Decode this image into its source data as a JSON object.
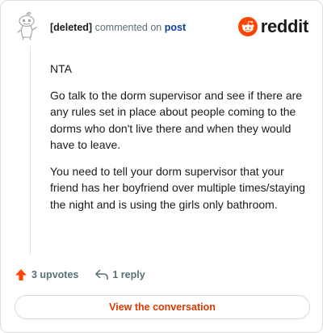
{
  "comment": {
    "author": "[deleted]",
    "action": "commented on",
    "target": "post",
    "paragraphs": [
      "NTA",
      "Go talk to the dorm supervisor and see if there are any rules set in place about people coming to the dorms who don't live there and when they would have to leave.",
      "You need to tell your dorm supervisor that your friend has her boyfriend over multiple times/staying the night and is using the girls only bathroom."
    ]
  },
  "brand": {
    "name": "reddit",
    "color": "#ff4500",
    "icon": "reddit-alien-icon"
  },
  "footer": {
    "upvotes": "3 upvotes",
    "replies": "1 reply",
    "upvote_icon": "upvote-arrow-icon",
    "reply_icon": "reply-arrow-icon",
    "upvote_color": "#ff4500"
  },
  "cta": {
    "label": "View the conversation",
    "color": "#d93900"
  }
}
